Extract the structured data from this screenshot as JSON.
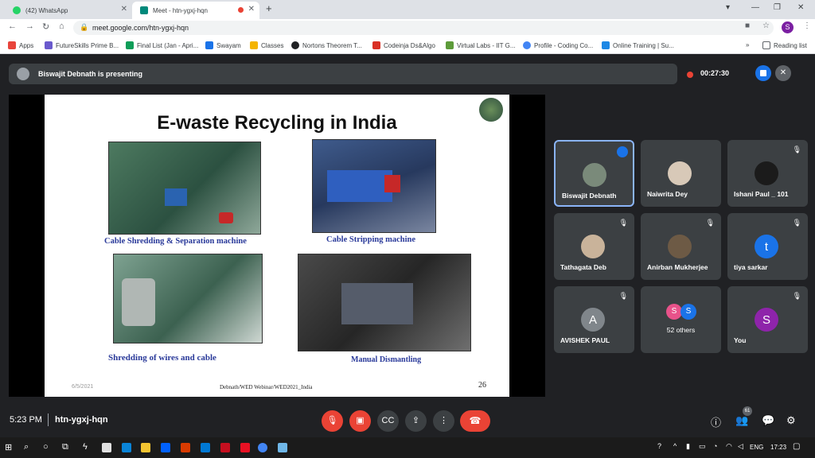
{
  "browser": {
    "tabs": [
      {
        "title": "(42) WhatsApp",
        "active": false
      },
      {
        "title": "Meet - htn-ygxj-hqn",
        "active": true
      }
    ],
    "new_tab": "+",
    "url": "meet.google.com/htn-ygxj-hqn",
    "profile_initial": "S",
    "bookmarks": [
      "Apps",
      "FutureSkills Prime B...",
      "Final List (Jan - Apri...",
      "Swayam",
      "Classes",
      "Nortons Theorem T...",
      "Codeinja Ds&Algo",
      "Virtual Labs - IIT G...",
      "Profile - Coding Co...",
      "Online Training | Su..."
    ],
    "reading_list": "Reading list",
    "more": "»"
  },
  "meet": {
    "presenting_text": "Biswajit Debnath is presenting",
    "recording_time": "00:27:30",
    "slide": {
      "title": "E-waste Recycling in India",
      "captions": [
        "Cable Shredding & Separation machine",
        "Cable Stripping machine",
        "Shredding of wires and cable",
        "Manual Dismantling"
      ],
      "footer": "Debnath/WED Webinar/WED2021_India",
      "date": "6/5/2021",
      "page": "26"
    },
    "participants": [
      {
        "name": "Biswajit Debnath",
        "initial": "",
        "color": "#7a8a7a",
        "speaking": true
      },
      {
        "name": "Naiwrita Dey",
        "initial": "",
        "color": "#d8c9b8",
        "speaking": false
      },
      {
        "name": "Ishani Paul _ 101",
        "initial": "",
        "color": "#1b1b1b",
        "speaking": false
      },
      {
        "name": "Tathagata Deb",
        "initial": "",
        "color": "#c9b39a",
        "speaking": false
      },
      {
        "name": "Anirban Mukherjee",
        "initial": "",
        "color": "#6d5a45",
        "speaking": false
      },
      {
        "name": "tiya sarkar",
        "initial": "t",
        "color": "#1a73e8",
        "speaking": false
      },
      {
        "name": "AVISHEK PAUL",
        "initial": "A",
        "color": "#80868b",
        "speaking": false
      },
      {
        "name": "52 others",
        "initial": "S",
        "color": "#e8528a",
        "speaking": false
      },
      {
        "name": "You",
        "initial": "S",
        "color": "#8e24aa",
        "speaking": false
      }
    ],
    "others_second_initial": "S",
    "time": "5:23 PM",
    "meeting_code": "htn-ygxj-hqn",
    "participant_count": "61"
  },
  "taskbar": {
    "lang": "ENG",
    "clock": "17:23"
  }
}
